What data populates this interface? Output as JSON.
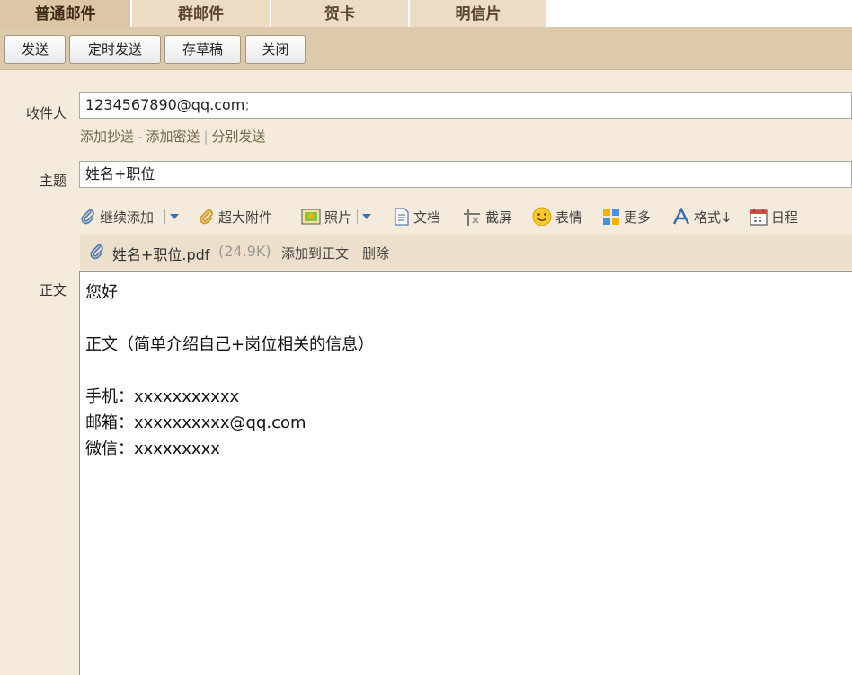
{
  "tabs": [
    "普通邮件",
    "群邮件",
    "贺卡",
    "明信片"
  ],
  "toolbar": {
    "send": "发送",
    "scheduled_send": "定时发送",
    "save_draft": "存草稿",
    "close": "关闭"
  },
  "recipient": {
    "label": "收件人",
    "value": "1234567890@qq.com",
    "separator": ";",
    "add_cc": "添加抄送",
    "add_bcc": "添加密送",
    "separate_send": "分别发送"
  },
  "subject": {
    "label": "主题",
    "value": "姓名+职位"
  },
  "compose_tools": {
    "continue_add": "继续添加",
    "large_attachment": "超大附件",
    "photo": "照片",
    "document": "文档",
    "screenshot": "截屏",
    "emoji": "表情",
    "more": "更多",
    "format": "格式↓",
    "schedule": "日程"
  },
  "attachment": {
    "filename": "姓名+职位.pdf",
    "size": "(24.9K)",
    "add_to_body": "添加到正文",
    "delete": "删除"
  },
  "body": {
    "label": "正文",
    "lines": [
      "您好",
      "",
      "正文（简单介绍自己+岗位相关的信息）",
      "",
      "手机：xxxxxxxxxxx",
      "邮箱：xxxxxxxxxx@qq.com",
      "微信：xxxxxxxxx"
    ]
  }
}
